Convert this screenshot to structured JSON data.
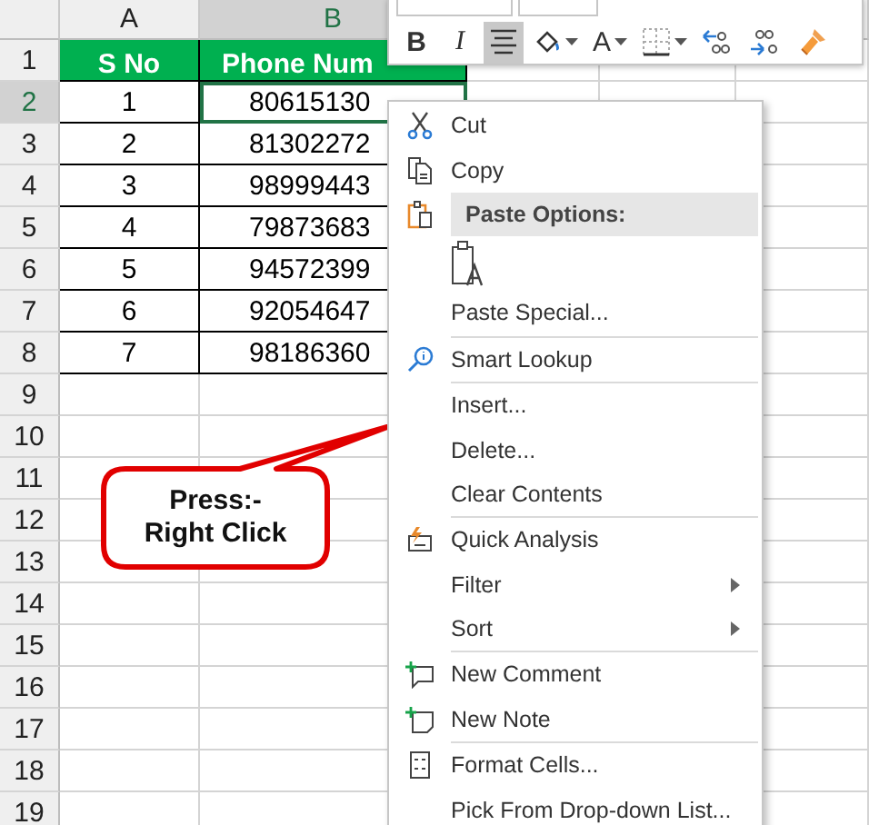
{
  "columns": [
    {
      "label": "A",
      "selected": false
    },
    {
      "label": "B",
      "selected": true
    }
  ],
  "rows": [
    {
      "number": "1",
      "selected": false,
      "kind": "header",
      "cells": [
        "S No",
        "Phone Num"
      ]
    },
    {
      "number": "2",
      "selected": true,
      "kind": "data",
      "cells": [
        "1",
        "80615130"
      ]
    },
    {
      "number": "3",
      "selected": false,
      "kind": "data",
      "cells": [
        "2",
        "81302272"
      ]
    },
    {
      "number": "4",
      "selected": false,
      "kind": "data",
      "cells": [
        "3",
        "98999443"
      ]
    },
    {
      "number": "5",
      "selected": false,
      "kind": "data",
      "cells": [
        "4",
        "79873683"
      ]
    },
    {
      "number": "6",
      "selected": false,
      "kind": "data",
      "cells": [
        "5",
        "94572399"
      ]
    },
    {
      "number": "7",
      "selected": false,
      "kind": "data",
      "cells": [
        "6",
        "92054647"
      ]
    },
    {
      "number": "8",
      "selected": false,
      "kind": "data",
      "cells": [
        "7",
        "98186360"
      ]
    },
    {
      "number": "9",
      "selected": false,
      "kind": "empty"
    },
    {
      "number": "10",
      "selected": false,
      "kind": "empty"
    },
    {
      "number": "11",
      "selected": false,
      "kind": "empty"
    },
    {
      "number": "12",
      "selected": false,
      "kind": "empty"
    },
    {
      "number": "13",
      "selected": false,
      "kind": "empty"
    },
    {
      "number": "14",
      "selected": false,
      "kind": "empty"
    },
    {
      "number": "15",
      "selected": false,
      "kind": "empty"
    },
    {
      "number": "16",
      "selected": false,
      "kind": "empty"
    },
    {
      "number": "17",
      "selected": false,
      "kind": "empty"
    },
    {
      "number": "18",
      "selected": false,
      "kind": "empty"
    },
    {
      "number": "19",
      "selected": false,
      "kind": "empty"
    }
  ],
  "toolbar": {
    "buttons": [
      {
        "kind": "bold",
        "label": "B",
        "selected": false
      },
      {
        "kind": "italic",
        "label": "I",
        "selected": false
      },
      {
        "kind": "center",
        "selected": true
      },
      {
        "kind": "fill",
        "selected": false
      },
      {
        "kind": "font-color",
        "label": "A",
        "selected": false
      },
      {
        "kind": "borders",
        "selected": false
      },
      {
        "kind": "decrease-decimal",
        "selected": false
      },
      {
        "kind": "increase-decimal",
        "selected": false
      },
      {
        "kind": "painter",
        "selected": false
      }
    ]
  },
  "context_menu": {
    "items": [
      {
        "kind": "item",
        "label": "Cut",
        "submenu": false
      },
      {
        "kind": "item",
        "label": "Copy",
        "submenu": false
      },
      {
        "kind": "header",
        "label": "Paste Options:"
      },
      {
        "kind": "paste-option"
      },
      {
        "kind": "item",
        "label": "Paste Special...",
        "submenu": false
      },
      {
        "kind": "separator"
      },
      {
        "kind": "item",
        "label": "Smart Lookup",
        "submenu": false
      },
      {
        "kind": "separator"
      },
      {
        "kind": "item",
        "label": "Insert...",
        "submenu": false
      },
      {
        "kind": "item",
        "label": "Delete...",
        "submenu": false
      },
      {
        "kind": "item",
        "label": "Clear Contents",
        "submenu": false
      },
      {
        "kind": "separator"
      },
      {
        "kind": "item",
        "label": "Quick Analysis",
        "submenu": false
      },
      {
        "kind": "item",
        "label": "Filter",
        "submenu": true
      },
      {
        "kind": "item",
        "label": "Sort",
        "submenu": true
      },
      {
        "kind": "separator"
      },
      {
        "kind": "item",
        "label": "New Comment",
        "submenu": false
      },
      {
        "kind": "item",
        "label": "New Note",
        "submenu": false
      },
      {
        "kind": "separator"
      },
      {
        "kind": "item",
        "label": "Format Cells...",
        "submenu": false
      },
      {
        "kind": "item",
        "label": "Pick From Drop-down List...",
        "submenu": false
      }
    ]
  },
  "callout": {
    "text": "Press:-\nRight Click"
  }
}
